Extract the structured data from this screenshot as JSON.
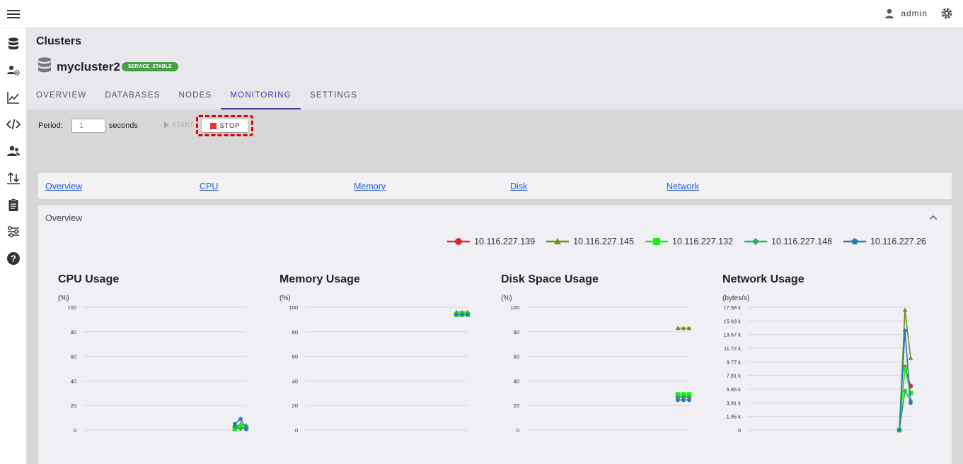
{
  "topbar": {
    "user": "admin",
    "user_icon": "person-icon",
    "settings_icon": "gear-icon"
  },
  "sidebar": {
    "icons": [
      "database-icon",
      "user-settings-icon",
      "chart-line-icon",
      "code-icon",
      "users-icon",
      "transfer-icon",
      "clipboard-icon",
      "settings-sliders-icon",
      "help-icon"
    ]
  },
  "header": {
    "breadcrumb": "Clusters",
    "cluster_name": "mycluster2",
    "status": "SERVICE_STABLE",
    "tabs": [
      "OVERVIEW",
      "DATABASES",
      "NODES",
      "MONITORING",
      "SETTINGS"
    ],
    "active_tab": "MONITORING"
  },
  "controls": {
    "period_label": "Period:",
    "period_value": "1",
    "period_unit": "seconds",
    "start_label": "START",
    "stop_label": "STOP"
  },
  "nav_links": [
    "Overview",
    "CPU",
    "Memory",
    "Disk",
    "Network"
  ],
  "overview": {
    "title": "Overview",
    "collapse_icon": "chevron-up-icon",
    "legend": [
      {
        "name": "10.116.227.139",
        "color": "#d32f2f",
        "marker": "circle"
      },
      {
        "name": "10.116.227.145",
        "color": "#6b8e23",
        "marker": "triangle"
      },
      {
        "name": "10.116.227.132",
        "color": "#19f019",
        "marker": "square"
      },
      {
        "name": "10.116.227.148",
        "color": "#27ae60",
        "marker": "diamond"
      },
      {
        "name": "10.116.227.26",
        "color": "#2a7ab8",
        "marker": "pentagon"
      }
    ]
  },
  "chart_data": [
    {
      "type": "line",
      "title": "CPU Usage",
      "ylabel": "(%)",
      "yticks": [
        "0",
        "20",
        "40",
        "60",
        "80",
        "100"
      ],
      "ylim": [
        0,
        100
      ],
      "x": [
        0,
        1,
        2
      ],
      "series": [
        {
          "name": "10.116.227.139",
          "values": [
            3,
            2,
            1
          ]
        },
        {
          "name": "10.116.227.145",
          "values": [
            2,
            5,
            4
          ]
        },
        {
          "name": "10.116.227.132",
          "values": [
            1,
            3,
            2
          ]
        },
        {
          "name": "10.116.227.148",
          "values": [
            2,
            1,
            3
          ]
        },
        {
          "name": "10.116.227.26",
          "values": [
            5,
            9,
            1
          ]
        }
      ]
    },
    {
      "type": "line",
      "title": "Memory Usage",
      "ylabel": "(%)",
      "yticks": [
        "0",
        "20",
        "40",
        "60",
        "80",
        "100"
      ],
      "ylim": [
        0,
        100
      ],
      "x": [
        0,
        1,
        2
      ],
      "series": [
        {
          "name": "10.116.227.139",
          "values": [
            94,
            94,
            94
          ]
        },
        {
          "name": "10.116.227.145",
          "values": [
            96,
            96,
            96
          ]
        },
        {
          "name": "10.116.227.132",
          "values": [
            94,
            94,
            94
          ]
        },
        {
          "name": "10.116.227.148",
          "values": [
            94,
            94,
            94
          ]
        },
        {
          "name": "10.116.227.26",
          "values": [
            94,
            94,
            94
          ]
        }
      ]
    },
    {
      "type": "line",
      "title": "Disk Space Usage",
      "ylabel": "(%)",
      "yticks": [
        "0",
        "20",
        "40",
        "60",
        "80",
        "100"
      ],
      "ylim": [
        0,
        100
      ],
      "x": [
        0,
        1,
        2
      ],
      "series": [
        {
          "name": "10.116.227.139",
          "values": [
            27,
            27,
            27
          ]
        },
        {
          "name": "10.116.227.145",
          "values": [
            83,
            83,
            83
          ]
        },
        {
          "name": "10.116.227.132",
          "values": [
            29,
            29,
            29
          ]
        },
        {
          "name": "10.116.227.148",
          "values": [
            27,
            27,
            27
          ]
        },
        {
          "name": "10.116.227.26",
          "values": [
            24.5,
            24.5,
            24.5
          ]
        }
      ]
    },
    {
      "type": "line",
      "title": "Network Usage",
      "ylabel": "(bytes/s)",
      "yticks": [
        "0",
        "1.95 k",
        "3.91 k",
        "5.86 k",
        "7.81 k",
        "9.77 k",
        "11.72 k",
        "13.67 k",
        "15.63 k",
        "17.58 k"
      ],
      "ylim": [
        0,
        17580
      ],
      "x": [
        0,
        1,
        2
      ],
      "series": [
        {
          "name": "10.116.227.139",
          "values": [
            0,
            9000,
            6300
          ]
        },
        {
          "name": "10.116.227.145",
          "values": [
            0,
            17200,
            10300
          ]
        },
        {
          "name": "10.116.227.132",
          "values": [
            0,
            8800,
            5300
          ]
        },
        {
          "name": "10.116.227.148",
          "values": [
            0,
            5600,
            4200
          ]
        },
        {
          "name": "10.116.227.26",
          "values": [
            0,
            14200,
            3900
          ]
        }
      ]
    }
  ]
}
